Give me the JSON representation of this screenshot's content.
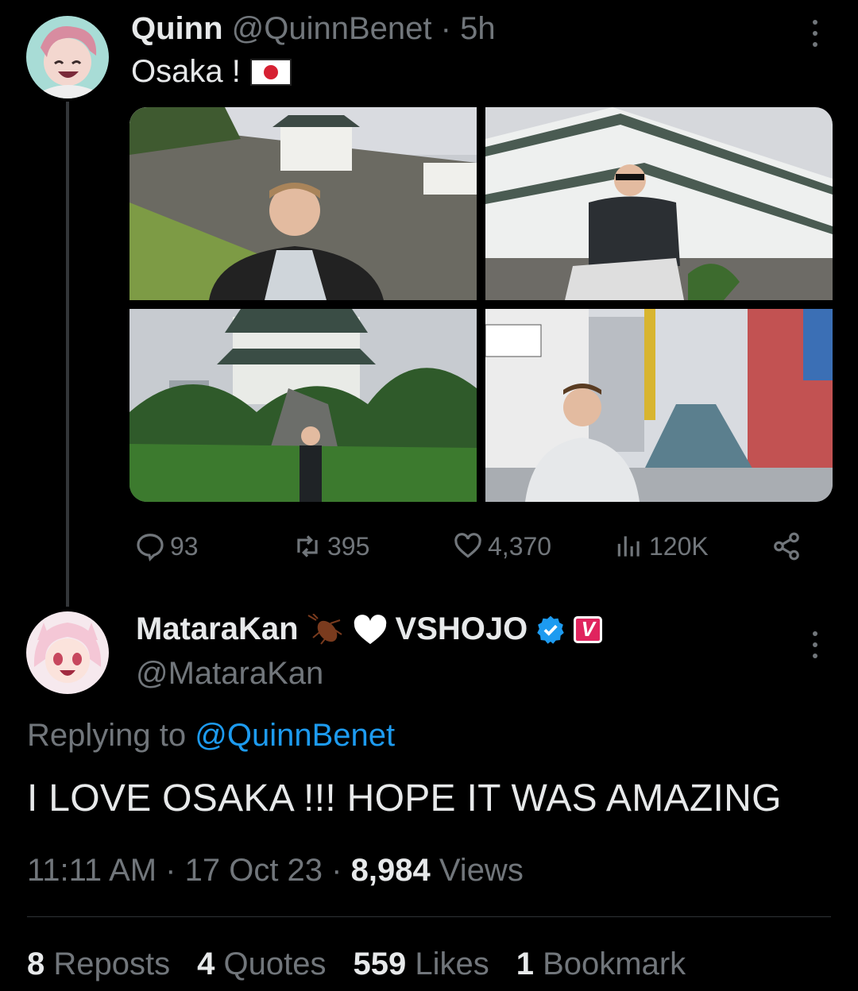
{
  "tweet1": {
    "display_name": "Quinn",
    "handle": "@QuinnBenet",
    "time": "5h",
    "text": "Osaka !",
    "flag": "japan-flag",
    "stats": {
      "replies": "93",
      "reposts": "395",
      "likes": "4,370",
      "views": "120K"
    }
  },
  "tweet2": {
    "display_name": "MataraKan",
    "name_emojis": [
      "cockroach-emoji",
      "white-heart-emoji"
    ],
    "org": "VSHOJO",
    "badge": "V",
    "handle": "@MataraKan",
    "replying_prefix": "Replying to",
    "replying_to": "@QuinnBenet",
    "text": "I LOVE OSAKA !!! HOPE IT WAS AMAZING",
    "timestamp": "11:11 AM · 17 Oct 23 ·",
    "views_count": "8,984",
    "views_label": "Views",
    "reposts_count": "8",
    "reposts_label": "Reposts",
    "quotes_count": "4",
    "quotes_label": "Quotes",
    "likes_count": "559",
    "likes_label": "Likes",
    "bookmarks_count": "1",
    "bookmarks_label": "Bookmark"
  },
  "colors": {
    "background": "#000000",
    "text": "#e7e9ea",
    "muted": "#71767b",
    "link": "#1d9bf0",
    "verified": "#1d9bf0",
    "badge": "#e0245e"
  }
}
